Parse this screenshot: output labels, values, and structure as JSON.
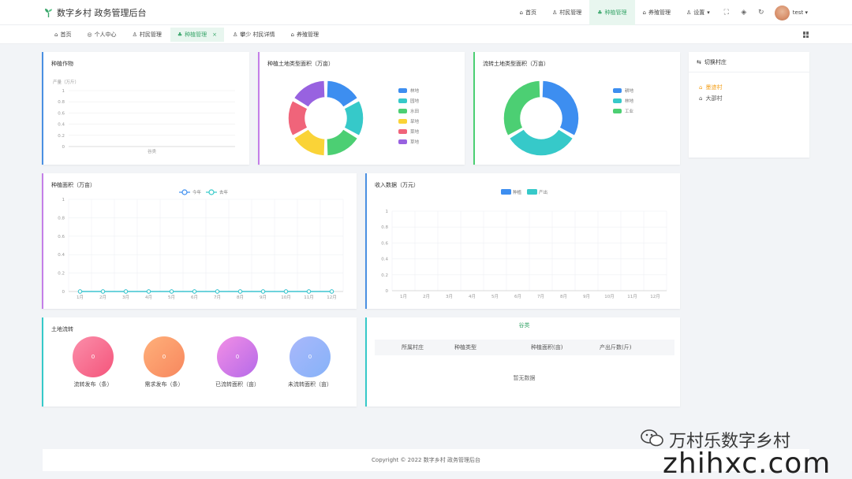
{
  "brand": {
    "title": "数字乡村 政务管理后台"
  },
  "topnav": {
    "items": [
      {
        "label": "首页",
        "icon": "home-icon",
        "active": false
      },
      {
        "label": "村民管理",
        "icon": "person-icon",
        "active": false
      },
      {
        "label": "种植管理",
        "icon": "plant-icon",
        "active": true
      },
      {
        "label": "养殖管理",
        "icon": "barn-icon",
        "active": false
      },
      {
        "label": "设置",
        "icon": "user-settings-icon",
        "active": false
      }
    ],
    "user": "test"
  },
  "tabs": [
    {
      "label": "首页",
      "active": false
    },
    {
      "label": "个人中心",
      "active": false
    },
    {
      "label": "村民管理",
      "active": false
    },
    {
      "label": "种植管理",
      "active": true,
      "close": "×"
    },
    {
      "label": "攀少 村民详情",
      "active": false
    },
    {
      "label": "养殖管理",
      "active": false
    }
  ],
  "cards": {
    "planting_crops": {
      "title": "种植作物",
      "ylabel": "产量（万斤）",
      "category": "谷类"
    },
    "land_type": {
      "title": "种植土地类型面积（万亩）"
    },
    "transfer_land_type": {
      "title": "流转土地类型面积（万亩）"
    },
    "village_switch": {
      "title": "切换村庄",
      "items": [
        {
          "label": "墨迹村",
          "active": true
        },
        {
          "label": "大邵村",
          "active": false
        }
      ]
    },
    "planting_area": {
      "title": "种植面积（万亩）",
      "legend": [
        "今年",
        "去年"
      ]
    },
    "income": {
      "title": "收入数据（万元）",
      "legend": [
        "种植",
        "产出"
      ]
    },
    "land_transfer": {
      "title": "土地流转",
      "stats": [
        {
          "value": "0",
          "label": "流转发布（条）"
        },
        {
          "value": "0",
          "label": "需求发布（条）"
        },
        {
          "value": "0",
          "label": "已流转面积（亩）"
        },
        {
          "value": "0",
          "label": "未流转面积（亩）"
        }
      ]
    },
    "grain_table": {
      "tab": "谷类",
      "columns": [
        "所属村庄",
        "种植类型",
        "种植面积(亩)",
        "产出斤数(斤)"
      ],
      "empty": "暂无数据"
    }
  },
  "footer": {
    "text": "Copyright © 2022 数字乡村 政务管理后台"
  },
  "watermark": {
    "line1": "万村乐数字乡村",
    "line2": "zhihxc.com"
  },
  "chart_data": [
    {
      "type": "bar",
      "title": "种植作物",
      "ylabel": "产量（万斤）",
      "categories": [
        "谷类"
      ],
      "values": [
        0
      ],
      "ylim": [
        0,
        1
      ],
      "yticks": [
        "0",
        "0.2",
        "0.4",
        "0.6",
        "0.8",
        "1"
      ]
    },
    {
      "type": "pie",
      "title": "种植土地类型面积（万亩）",
      "labels": [
        "林地",
        "园地",
        "水田",
        "旱地",
        "菜地",
        "草地"
      ],
      "values": [
        1,
        1,
        1,
        1,
        1,
        1
      ],
      "colors": [
        "#3d8ef0",
        "#36c9c9",
        "#4ccf73",
        "#fad337",
        "#f0647a",
        "#9862e0"
      ]
    },
    {
      "type": "pie",
      "title": "流转土地类型面积（万亩）",
      "labels": [
        "耕地",
        "林地",
        "工业"
      ],
      "values": [
        1,
        1,
        1
      ],
      "colors": [
        "#3d8ef0",
        "#36c9c9",
        "#4ccf73"
      ]
    },
    {
      "type": "line",
      "title": "种植面积（万亩）",
      "categories": [
        "1月",
        "2月",
        "3月",
        "4月",
        "5月",
        "6月",
        "7月",
        "8月",
        "9月",
        "10月",
        "11月",
        "12月"
      ],
      "series": [
        {
          "name": "今年",
          "values": [
            0,
            0,
            0,
            0,
            0,
            0,
            0,
            0,
            0,
            0,
            0,
            0
          ],
          "color": "#3d8ef0"
        },
        {
          "name": "去年",
          "values": [
            0,
            0,
            0,
            0,
            0,
            0,
            0,
            0,
            0,
            0,
            0,
            0
          ],
          "color": "#36c9c9"
        }
      ],
      "ylim": [
        0,
        1
      ],
      "yticks": [
        "0",
        "0.2",
        "0.4",
        "0.6",
        "0.8",
        "1"
      ]
    },
    {
      "type": "bar",
      "title": "收入数据（万元）",
      "categories": [
        "1月",
        "2月",
        "3月",
        "4月",
        "5月",
        "6月",
        "7月",
        "8月",
        "9月",
        "10月",
        "11月",
        "12月"
      ],
      "series": [
        {
          "name": "种植",
          "values": [
            0,
            0,
            0,
            0,
            0,
            0,
            0,
            0,
            0,
            0,
            0,
            0
          ],
          "color": "#3d8ef0"
        },
        {
          "name": "产出",
          "values": [
            0,
            0,
            0,
            0,
            0,
            0,
            0,
            0,
            0,
            0,
            0,
            0
          ],
          "color": "#36c9c9"
        }
      ],
      "ylim": [
        0,
        1
      ],
      "yticks": [
        "0",
        "0.2",
        "0.4",
        "0.6",
        "0.8",
        "1"
      ]
    }
  ]
}
